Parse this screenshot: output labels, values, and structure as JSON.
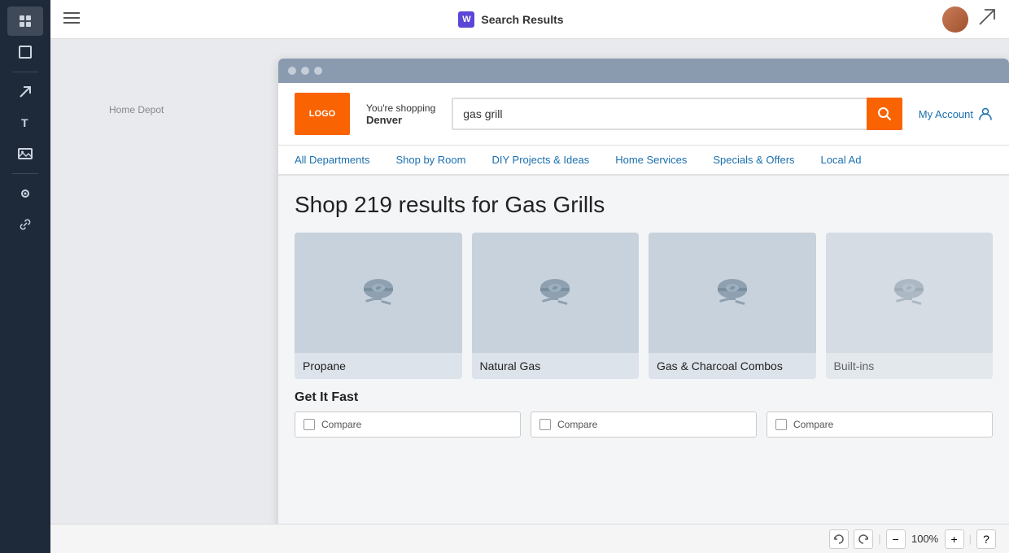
{
  "topbar": {
    "menu_icon": "≡",
    "app_name": "Search Results",
    "w_badge": "W",
    "send_icon": "✈"
  },
  "toolbar": {
    "items": [
      {
        "name": "layers-icon",
        "icon": "⊞",
        "active": true
      },
      {
        "name": "frame-icon",
        "icon": "⬜",
        "active": false
      },
      {
        "name": "arrow-icon",
        "icon": "↗",
        "active": false
      },
      {
        "name": "text-icon",
        "icon": "T",
        "active": false
      },
      {
        "name": "image-icon",
        "icon": "🖼",
        "active": false
      },
      {
        "name": "component-icon",
        "icon": "⊙",
        "active": false
      },
      {
        "name": "link-icon",
        "icon": "⛓",
        "active": false
      }
    ]
  },
  "browser": {
    "dots": [
      "dot1",
      "dot2",
      "dot3"
    ]
  },
  "breadcrumb": "Home Depot",
  "hd": {
    "logo_text": "LOGO",
    "shopping_label": "You're shopping",
    "location": "Denver",
    "search_value": "gas grill",
    "search_placeholder": "Search",
    "account_label": "My Account",
    "nav_items": [
      {
        "label": "All Departments"
      },
      {
        "label": "Shop by Room"
      },
      {
        "label": "DIY Projects & Ideas"
      },
      {
        "label": "Home Services"
      },
      {
        "label": "Specials & Offers"
      },
      {
        "label": "Local Ad"
      }
    ]
  },
  "results": {
    "title": "Shop 219 results for Gas Grills",
    "categories": [
      {
        "label": "Propane"
      },
      {
        "label": "Natural Gas"
      },
      {
        "label": "Gas & Charcoal Combos"
      },
      {
        "label": "Built-ins"
      }
    ],
    "get_it_fast_label": "Get It Fast",
    "compare_label": "Compare"
  },
  "bottombar": {
    "undo_icon": "↩",
    "redo_icon": "↪",
    "zoom_minus": "−",
    "zoom_value": "100%",
    "zoom_plus": "+",
    "more_icon": "?",
    "separator": "│"
  }
}
